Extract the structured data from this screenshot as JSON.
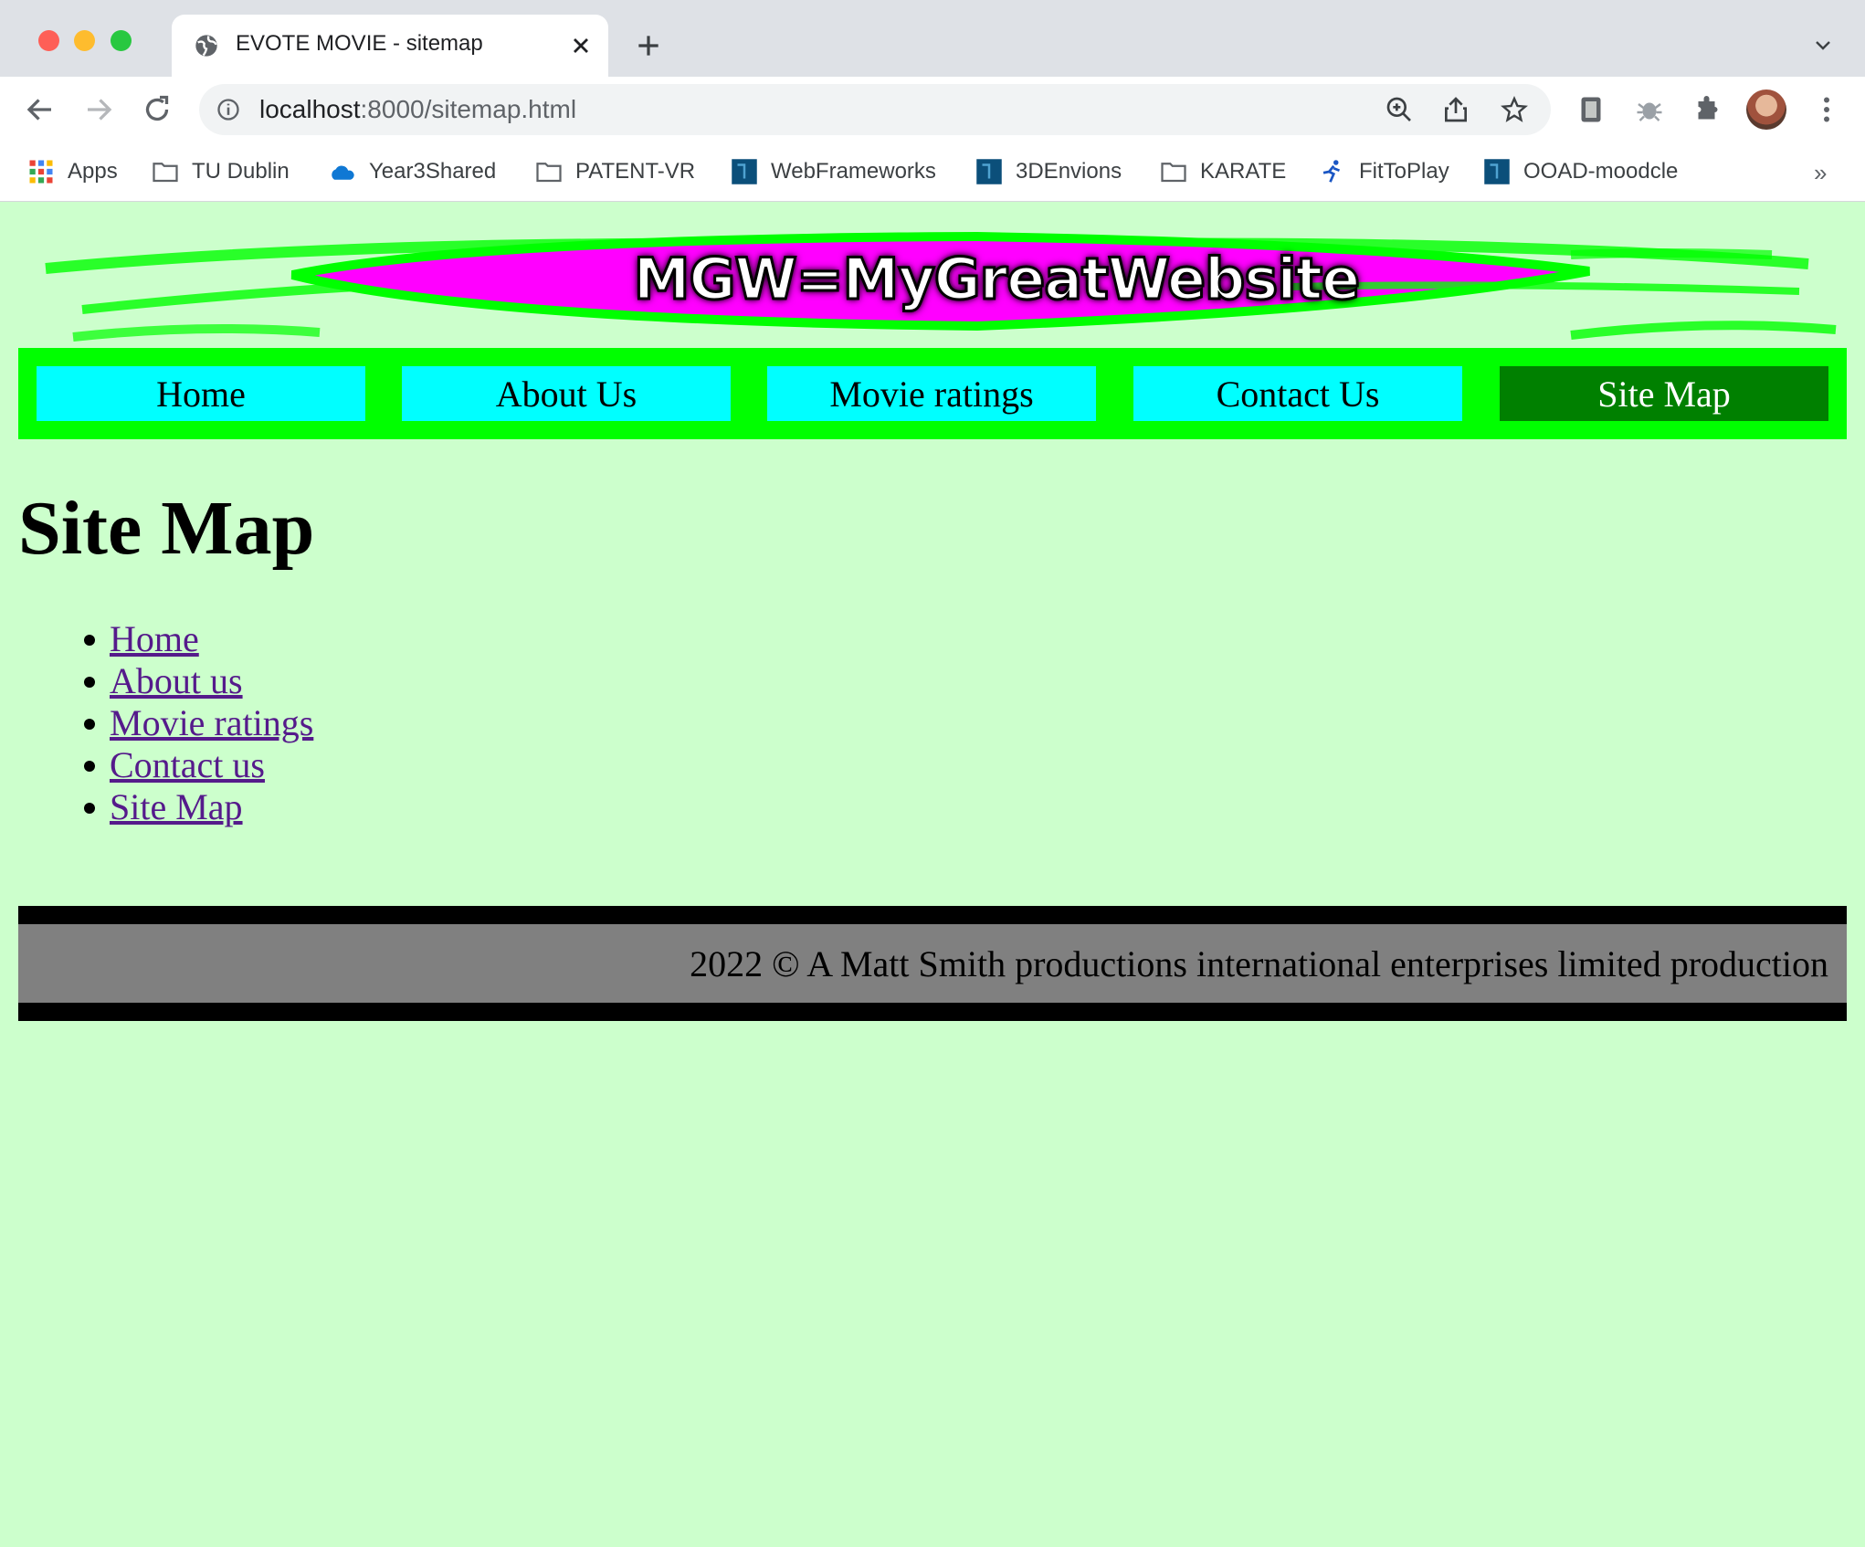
{
  "browser": {
    "tab_title": "EVOTE MOVIE - sitemap",
    "url_host": "localhost",
    "url_path": ":8000/sitemap.html",
    "bookmarks": [
      {
        "label": "Apps",
        "icon": "apps-grid-icon"
      },
      {
        "label": "TU Dublin",
        "icon": "folder-icon"
      },
      {
        "label": "Year3Shared",
        "icon": "onedrive-cloud-icon"
      },
      {
        "label": "PATENT-VR",
        "icon": "folder-icon"
      },
      {
        "label": "WebFrameworks",
        "icon": "site-favicon-icon"
      },
      {
        "label": "3DEnvions",
        "icon": "site-favicon-icon"
      },
      {
        "label": "KARATE",
        "icon": "folder-icon"
      },
      {
        "label": "FitToPlay",
        "icon": "runner-icon"
      },
      {
        "label": "OOAD-moodcle",
        "icon": "site-favicon-icon"
      }
    ],
    "bookmarks_more": "»"
  },
  "site": {
    "banner_title": "MGW=MyGreatWebsite",
    "nav": [
      {
        "label": "Home"
      },
      {
        "label": "About Us"
      },
      {
        "label": "Movie ratings"
      },
      {
        "label": "Contact Us"
      },
      {
        "label": "Site Map",
        "active": true
      }
    ],
    "heading": "Site Map",
    "links": [
      {
        "label": "Home"
      },
      {
        "label": "About us"
      },
      {
        "label": "Movie ratings"
      },
      {
        "label": "Contact us"
      },
      {
        "label": "Site Map"
      }
    ],
    "footer": "2022 © A Matt Smith productions international enterprises limited production"
  },
  "colors": {
    "page_bg": "#ccffcc",
    "nav_bg": "#00ff00",
    "nav_item": "#00ffff",
    "nav_active": "#008000",
    "banner_magenta": "#ff00ff",
    "footer_bg": "#808080",
    "link": "#551a8b"
  }
}
